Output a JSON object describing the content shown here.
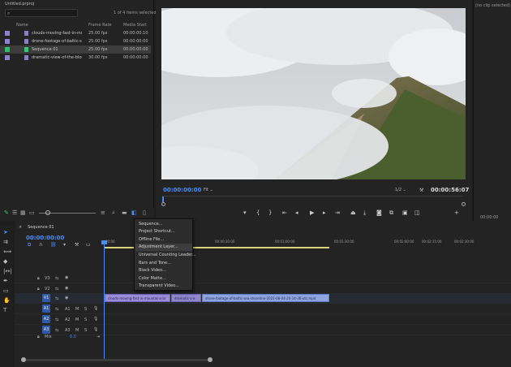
{
  "project": {
    "title": "Untitled.prproj",
    "search_placeholder": "",
    "selection_count": "1 of 4 items selected",
    "columns": {
      "name": "Name",
      "frame_rate": "Frame Rate",
      "media_start": "Media Start"
    },
    "items": [
      {
        "name": "clouds-moving-fast-in-moun",
        "frame_rate": "25.00 fps",
        "media_start": "00:00:00:10",
        "swatch": "#8f80d0",
        "selected": false
      },
      {
        "name": "drone-footage-of-baltic-sea-",
        "frame_rate": "25.00 fps",
        "media_start": "00:00:00:00",
        "swatch": "#8f80d0",
        "selected": false
      },
      {
        "name": "Sequence 01",
        "frame_rate": "25.00 fps",
        "media_start": "00:00:00:00",
        "swatch": "#2fbf6a",
        "selected": true
      },
      {
        "name": "dramatic-view-of-the-block-l",
        "frame_rate": "30.00 fps",
        "media_start": "00:00:00:00",
        "swatch": "#8f80d0",
        "selected": false
      }
    ]
  },
  "monitor": {
    "timecode": "00:00:00:00",
    "fit": "Fit",
    "resolution": "1/2",
    "duration": "00:00:56:07"
  },
  "info": {
    "no_clip": "(no clip selected)",
    "timecode": "00:00:00"
  },
  "timeline": {
    "sequence_tab": "Sequence 01",
    "timecode": "00:00:00:00",
    "ruler": [
      "00:00",
      "00:00:30:00",
      "00:01:00:00",
      "00:01:30:00",
      "00:02:00:00",
      "00:02:15:00",
      "00:02:30:00"
    ],
    "tracks": {
      "v3": "V3",
      "v2": "V2",
      "v1": "V1",
      "a1": "A1",
      "a2": "A2",
      "a3": "A3",
      "v1_target": "V1",
      "a1_target": "A1",
      "a2_target": "A2",
      "a3_target": "A3",
      "m": "M",
      "s": "S",
      "mix": "Mix",
      "mix_value": "0.0"
    },
    "clips": [
      {
        "label": "clouds-moving-fast-in-mountains-br"
      },
      {
        "label": "dramatic-v-e"
      },
      {
        "label": "drone-footage-of-baltic-sea-shoreline-2022-08-04-20-14-36-utc.mp4"
      }
    ]
  },
  "context_menu": {
    "items": [
      "Sequence...",
      "Project Shortcut...",
      "Offline File...",
      "Adjustment Layer...",
      "Universal Counting Leader...",
      "Bars and Tone...",
      "Black Video...",
      "Color Matte...",
      "Transparent Video..."
    ],
    "highlighted": "Adjustment Layer..."
  },
  "colors": {
    "accent": "#4a8cf7",
    "clip_video": "#9a8cd8",
    "clip_drone": "#8da4e0",
    "workbar": "#d8d27a"
  }
}
